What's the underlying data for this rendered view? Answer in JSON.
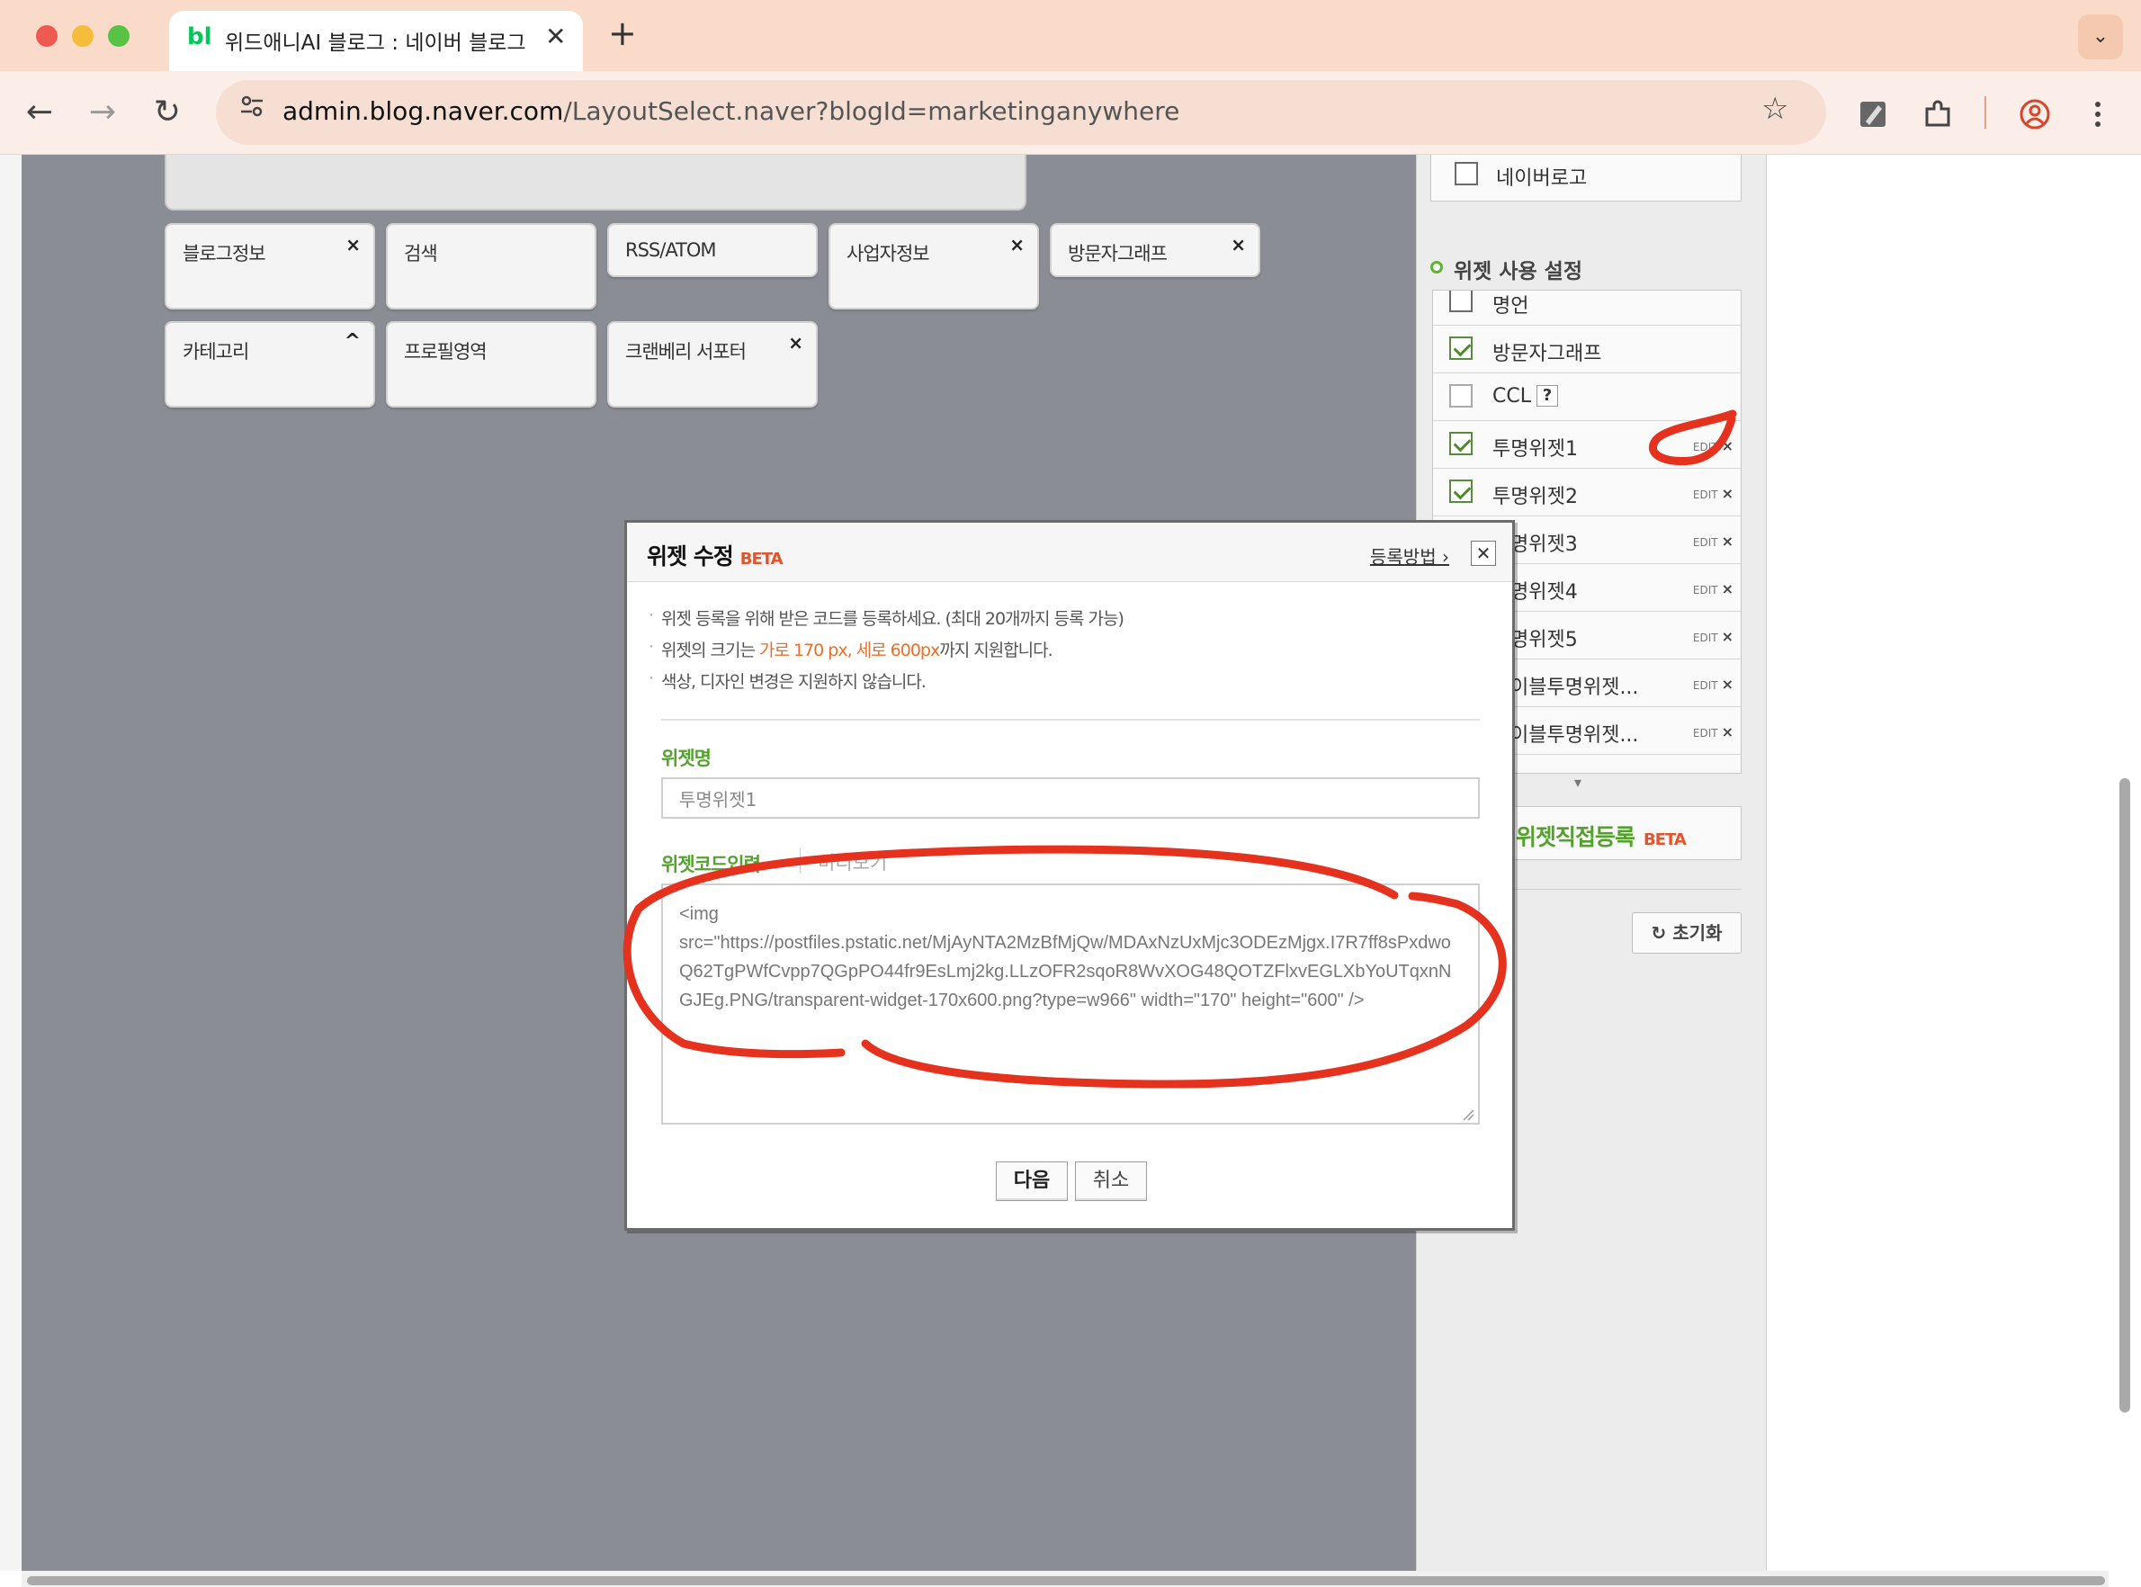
{
  "browser": {
    "tab": {
      "favicon": "bl",
      "title": "위드애니AI 블로그 : 네이버 블로그",
      "close": "✕"
    },
    "new_tab": "+",
    "tab_dropdown": "⌄",
    "nav": {
      "back": "←",
      "forward": "→",
      "reload": "↻"
    },
    "url_host": "admin.blog.naver.com",
    "url_path": "/LayoutSelect.naver?blogId=marketinganywhere",
    "icons": {
      "site_info": "site-info-icon",
      "star": "star-icon",
      "pen": "pen-icon",
      "extension": "extension-icon",
      "profile": "profile-icon",
      "menu": "kebab-menu-icon"
    }
  },
  "layout_widgets": [
    {
      "label": "블로그정보",
      "control": "×"
    },
    {
      "label": "검색",
      "control": ""
    },
    {
      "label": "RSS/ATOM",
      "control": ""
    },
    {
      "label": "사업자정보",
      "control": "×"
    },
    {
      "label": "방문자그래프",
      "control": "×"
    },
    {
      "label": "카테고리",
      "control": "^"
    },
    {
      "label": "프로필영역",
      "control": ""
    },
    {
      "label": "크랜베리 서포터",
      "control": "×"
    }
  ],
  "right_panel": {
    "top_item": {
      "label": "네이버로고",
      "checked": false
    },
    "section_title": "위젯 사용 설정",
    "items": [
      {
        "label": "명언",
        "checked": false,
        "edit": false
      },
      {
        "label": "방문자그래프",
        "checked": true,
        "edit": false
      },
      {
        "label": "CCL",
        "checked": false,
        "edit": false,
        "help": "?"
      },
      {
        "label": "투명위젯1",
        "checked": true,
        "edit": true
      },
      {
        "label": "투명위젯2",
        "checked": true,
        "edit": true
      },
      {
        "label": "명위젯3",
        "checked": null,
        "edit": true
      },
      {
        "label": "명위젯4",
        "checked": null,
        "edit": true
      },
      {
        "label": "명위젯5",
        "checked": null,
        "edit": true
      },
      {
        "label": "이블투명위젯...",
        "checked": null,
        "edit": true
      },
      {
        "label": "이블투명위젯...",
        "checked": null,
        "edit": true
      }
    ],
    "edit_label": "EDIT",
    "edit_close": "×",
    "direct_register": "위젯직접등록",
    "direct_beta": "BETA",
    "reset": "초기화",
    "reset_icon": "↻"
  },
  "modal": {
    "title": "위젯 수정",
    "beta": "BETA",
    "howto": "등록방법",
    "howto_arrow": "›",
    "close": "✕",
    "notes": {
      "line1": "위젯 등록을 위해 받은 코드를 등록하세요. (최대 20개까지 등록 가능)",
      "line2_pre": "위젯의 크기는 ",
      "line2_hl": "가로 170 px, 세로 600px",
      "line2_post": "까지 지원합니다.",
      "line3": "색상, 디자인 변경은 지원하지 않습니다."
    },
    "name_label": "위젯명",
    "name_value": "투명위젯1",
    "code_label": "위젯코드입력",
    "code_arrow": "⌄",
    "preview_tab": "미리보기",
    "code_value": "<img src=\"https://postfiles.pstatic.net/MjAyNTA2MzBfMjQw/MDAxNzUxMjc3ODEzMjgx.I7R7ff8sPxdwoQ62TgPWfCvpp7QGpPO44fr9EsLmj2kg.LLzOFR2sqoR8WvXOG48QOTZFlxvEGLXbYoUTqxnNGJEg.PNG/transparent-widget-170x600.png?type=w966\" width=\"170\" height=\"600\" />",
    "next": "다음",
    "cancel": "취소"
  },
  "colors": {
    "accent_green": "#54a32d",
    "beta_orange": "#e2542c",
    "annotation_red": "#e5321f",
    "workspace_gray": "#8a8d93"
  }
}
